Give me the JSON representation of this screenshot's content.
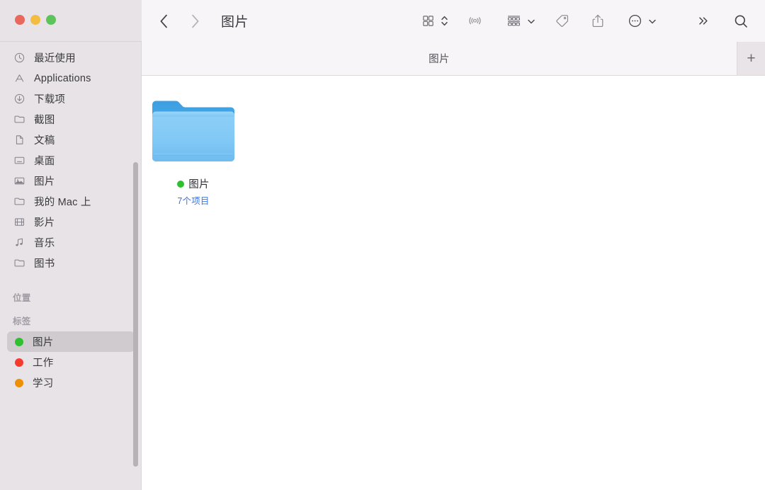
{
  "window": {
    "traffic_lights": [
      {
        "name": "close",
        "color": "#e8685d"
      },
      {
        "name": "minimize",
        "color": "#f2bd42"
      },
      {
        "name": "maximize",
        "color": "#5cc45a"
      }
    ]
  },
  "toolbar": {
    "back_icon": "chevron-left-icon",
    "forward_icon": "chevron-right-icon",
    "title": "图片",
    "buttons": [
      {
        "name": "view-grid-button",
        "icon": "grid-view-icon",
        "has_chevron": true
      },
      {
        "name": "airdrop-button",
        "icon": "airdrop-icon",
        "has_chevron": false
      },
      {
        "name": "group-by-button",
        "icon": "group-by-icon",
        "has_chevron": true
      },
      {
        "name": "tags-button",
        "icon": "tag-icon",
        "has_chevron": false
      },
      {
        "name": "share-button",
        "icon": "share-icon",
        "has_chevron": false
      },
      {
        "name": "more-actions-button",
        "icon": "ellipsis-circle-icon",
        "has_chevron": true
      },
      {
        "name": "overflow-button",
        "icon": "double-chevron-right-icon",
        "has_chevron": false
      },
      {
        "name": "search-button",
        "icon": "search-icon",
        "has_chevron": false
      }
    ]
  },
  "tabbar": {
    "active_tab_label": "图片",
    "new_tab_label": "+"
  },
  "sidebar": {
    "groups": [
      {
        "header": null,
        "items": [
          {
            "label": "最近使用",
            "icon": "clock-icon",
            "name": "sidebar-item-recents"
          },
          {
            "label": "Applications",
            "icon": "applications-icon",
            "name": "sidebar-item-applications"
          },
          {
            "label": "下载项",
            "icon": "download-icon",
            "name": "sidebar-item-downloads"
          },
          {
            "label": "截图",
            "icon": "folder-icon",
            "name": "sidebar-item-screenshots"
          },
          {
            "label": "文稿",
            "icon": "document-icon",
            "name": "sidebar-item-documents"
          },
          {
            "label": "桌面",
            "icon": "desktop-icon",
            "name": "sidebar-item-desktop"
          },
          {
            "label": "图片",
            "icon": "pictures-icon",
            "name": "sidebar-item-pictures"
          },
          {
            "label": "我的 Mac 上",
            "icon": "folder-icon",
            "name": "sidebar-item-on-my-mac"
          },
          {
            "label": "影片",
            "icon": "movies-icon",
            "name": "sidebar-item-movies"
          },
          {
            "label": "音乐",
            "icon": "music-icon",
            "name": "sidebar-item-music"
          },
          {
            "label": "图书",
            "icon": "folder-icon",
            "name": "sidebar-item-books"
          }
        ]
      },
      {
        "header": "位置",
        "items": []
      },
      {
        "header": "标签",
        "items": [
          {
            "label": "图片",
            "dot_color": "#2ec02e",
            "selected": true,
            "name": "sidebar-tag-pictures"
          },
          {
            "label": "工作",
            "dot_color": "#f63a2e",
            "selected": false,
            "name": "sidebar-tag-work"
          },
          {
            "label": "学习",
            "dot_color": "#ef8f04",
            "selected": false,
            "name": "sidebar-tag-study"
          }
        ]
      }
    ]
  },
  "content": {
    "items": [
      {
        "name": "图片",
        "subtitle": "7个项目",
        "tag_color": "#2ec02e",
        "icon": "folder-icon"
      }
    ]
  },
  "colors": {
    "sidebar_bg": "#e7e3e7",
    "toolbar_bg": "#f8f5f8",
    "content_bg": "#ffffff",
    "selection_bg": "#cfcbcf",
    "folder_blue": "#7fc6f5",
    "folder_blue_dark": "#3f9fe0",
    "subtitle_blue": "#3f73dd"
  }
}
